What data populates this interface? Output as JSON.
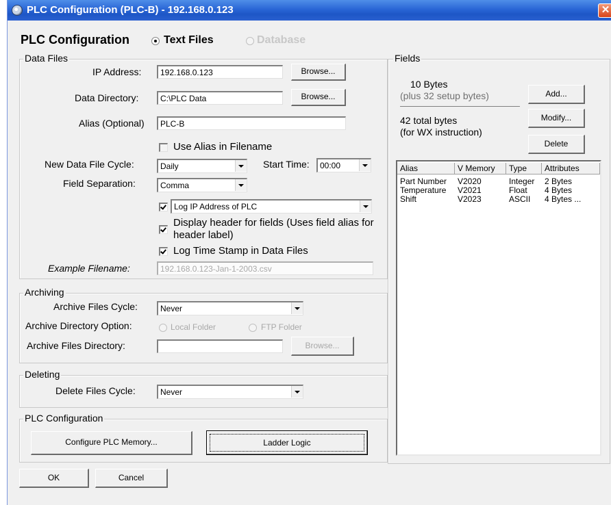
{
  "window": {
    "title": "PLC Configuration (PLC-B) - 192.168.0.123",
    "close_glyph": "✕"
  },
  "header": {
    "title": "PLC Configuration",
    "mode_text_files": "Text Files",
    "mode_database": "Database"
  },
  "data_files": {
    "group_label": "Data Files",
    "ip_label": "IP Address:",
    "ip_value": "192.168.0.123",
    "browse_label": "Browse...",
    "dir_label": "Data Directory:",
    "dir_value": "C:\\PLC Data",
    "alias_label": "Alias (Optional)",
    "alias_value": "PLC-B",
    "use_alias_label": "Use Alias in Filename",
    "cycle_label": "New Data File Cycle:",
    "cycle_value": "Daily",
    "start_time_label": "Start Time:",
    "start_time_value": "00:00",
    "separation_label": "Field Separation:",
    "separation_value": "Comma",
    "log_ip_value": "Log IP Address of PLC",
    "display_header_label": "Display header for fields (Uses field alias for header label)",
    "log_time_label": "Log Time Stamp in Data Files",
    "example_label": "Example Filename:",
    "example_value": "192.168.0.123-Jan-1-2003.csv"
  },
  "archiving": {
    "group_label": "Archiving",
    "cycle_label": "Archive Files Cycle:",
    "cycle_value": "Never",
    "dir_option_label": "Archive Directory Option:",
    "local_folder": "Local Folder",
    "ftp_folder": "FTP Folder",
    "dir_label": "Archive Files Directory:",
    "dir_value": "",
    "browse_label": "Browse..."
  },
  "deleting": {
    "group_label": "Deleting",
    "cycle_label": "Delete Files Cycle:",
    "cycle_value": "Never"
  },
  "plc_config": {
    "group_label": "PLC Configuration",
    "configure_memory": "Configure PLC Memory...",
    "ladder_logic": "Ladder Logic"
  },
  "footer": {
    "ok": "OK",
    "cancel": "Cancel"
  },
  "fields": {
    "group_label": "Fields",
    "bytes": "10  Bytes",
    "setup_bytes": "(plus 32 setup bytes)",
    "total_bytes": "42 total bytes",
    "wx_note": "(for WX instruction)",
    "add": "Add...",
    "modify": "Modify...",
    "delete": "Delete",
    "columns": [
      "Alias",
      "V Memory",
      "Type",
      "Attributes"
    ],
    "rows": [
      {
        "alias": "Part Number",
        "vmem": "V2020",
        "type": "Integer",
        "attr": "2 Bytes"
      },
      {
        "alias": "Temperature",
        "vmem": "V2021",
        "type": "Float",
        "attr": "4 Bytes"
      },
      {
        "alias": "Shift",
        "vmem": "V2023",
        "type": "ASCII",
        "attr": "4 Bytes ..."
      }
    ]
  }
}
